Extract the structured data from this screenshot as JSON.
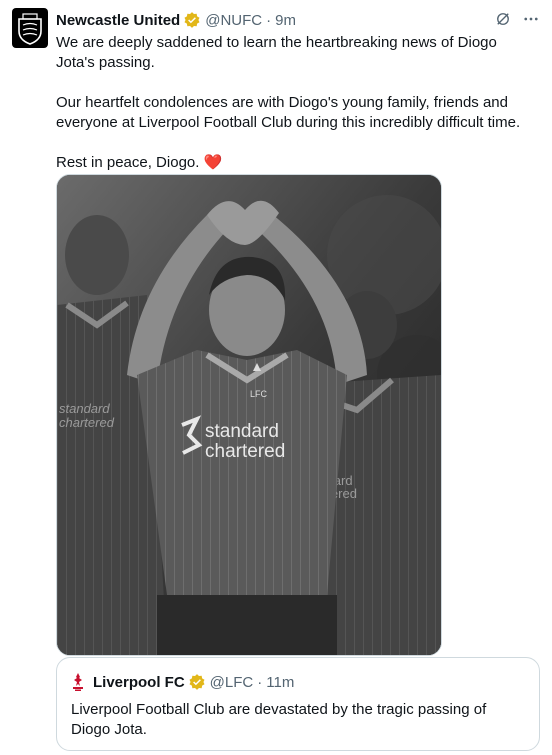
{
  "tweet": {
    "author_name": "Newcastle United",
    "handle": "@NUFC",
    "separator": "·",
    "time": "9m",
    "paragraphs": [
      "We are deeply saddened to learn the heartbreaking news of Diogo Jota's passing.",
      "Our heartfelt condolences are with Diogo's young family, friends and everyone at Liverpool Football Club during this incredibly difficult time.",
      "Rest in peace, Diogo."
    ],
    "heart_emoji": "❤️"
  },
  "media": {
    "sponsor_line1": "standard",
    "sponsor_line2": "chartered",
    "badge_text": "LFC"
  },
  "quote": {
    "author_name": "Liverpool FC",
    "handle": "@LFC",
    "separator": "·",
    "time": "11m",
    "text": "Liverpool Football Club are devastated by the tragic passing of Diogo Jota."
  },
  "icons": {
    "verified_color": "#e2b719",
    "accent_red": "#c8102e",
    "heart_color": "#e0245e"
  }
}
